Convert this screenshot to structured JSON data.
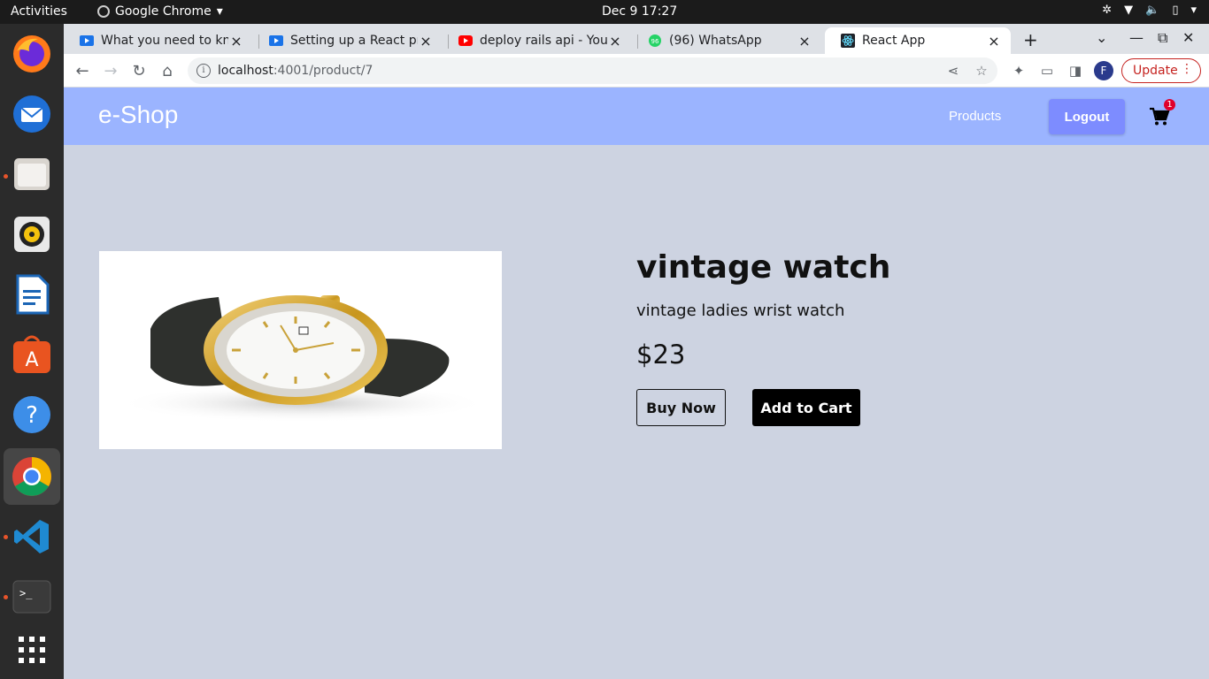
{
  "os": {
    "activities_label": "Activities",
    "app_name": "Google Chrome",
    "clock": "Dec 9  17:27"
  },
  "dock": {
    "items": [
      {
        "name": "firefox-icon"
      },
      {
        "name": "thunderbird-icon"
      },
      {
        "name": "files-icon"
      },
      {
        "name": "rhythmbox-icon"
      },
      {
        "name": "libreoffice-writer-icon"
      },
      {
        "name": "app-center-icon"
      },
      {
        "name": "help-icon"
      },
      {
        "name": "chrome-icon"
      },
      {
        "name": "vscode-icon"
      },
      {
        "name": "terminal-icon"
      },
      {
        "name": "show-apps-icon"
      }
    ]
  },
  "browser": {
    "tabs": [
      {
        "label": "What you need to kno",
        "icon": "video-icon"
      },
      {
        "label": "Setting up a React pro",
        "icon": "video-icon"
      },
      {
        "label": "deploy rails api - YouT",
        "icon": "youtube-icon"
      },
      {
        "label": "(96) WhatsApp",
        "icon": "whatsapp-icon"
      },
      {
        "label": "React App",
        "icon": "react-icon"
      }
    ],
    "url_host": "localhost",
    "url_path": ":4001/product/7",
    "profile_initial": "F",
    "update_label": "Update",
    "colors": {
      "update": "#c5221f",
      "profile": "#2a3a8c"
    }
  },
  "site": {
    "brand": "e-Shop",
    "nav_products": "Products",
    "logout": "Logout",
    "cart_count": "1",
    "colors": {
      "navbar": "#9bb4ff",
      "logout_bg": "#7d8cff",
      "page_bg": "#cdd3e1",
      "badge": "#e0002b"
    }
  },
  "product": {
    "title": "vintage watch",
    "description": "vintage ladies wrist watch",
    "price": "$23",
    "buy_label": "Buy Now",
    "add_to_cart_label": "Add to Cart"
  }
}
